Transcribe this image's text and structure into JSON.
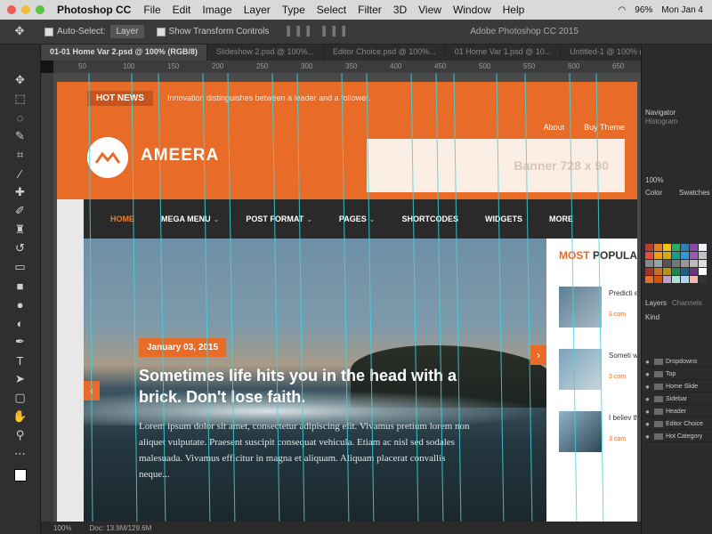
{
  "app": {
    "name": "Photoshop CC",
    "window_title": "Adobe Photoshop CC 2015",
    "menu": [
      "File",
      "Edit",
      "Image",
      "Layer",
      "Type",
      "Select",
      "Filter",
      "3D",
      "View",
      "Window",
      "Help"
    ],
    "clock": "Mon Jan 4",
    "battery": "96%"
  },
  "options_bar": {
    "auto_select_label": "Auto-Select:",
    "auto_select_value": "Layer",
    "transform_label": "Show Transform Controls"
  },
  "tabs": [
    "01-01 Home Var 2.psd @ 100% (RGB/8)",
    "Slideshow 2.psd @ 100%...",
    "Editor Choice.psd @ 100%...",
    "01 Home Var 1.psd @ 10...",
    "Untitled-1 @ 100% (phon..."
  ],
  "ruler": [
    "50",
    "100",
    "150",
    "200",
    "250",
    "300",
    "350",
    "400",
    "450",
    "500",
    "550",
    "600",
    "650"
  ],
  "site": {
    "hot_news": "HOT NEWS",
    "tagline": "Innovation distinguishes between a leader and a follower.",
    "logo": "AMEERA",
    "top_links": [
      "About",
      "Buy Theme"
    ],
    "banner": "Banner 728 x 90",
    "nav": [
      "HOME",
      "MEGA MENU",
      "POST FORMAT",
      "PAGES",
      "SHORTCODES",
      "WIDGETS",
      "MORE"
    ],
    "hero": {
      "date": "January 03, 2015",
      "headline": "Sometimes life hits you in the head with a brick. Don't lose faith.",
      "excerpt": "Lorem ipsum dolor sit amet, consectetur adipiscing elit. Vivamus pretium lorem non aliquet vulputate. Praesent suscipit consequat vehicula. Etiam ac nisl sed sodales malesuada. Vivamus efficitur in magna et aliquam. Aliquam placerat convallis neque...",
      "prev_arrow": "‹",
      "next_arrow": "›"
    },
    "popular": {
      "title_accent": "MOST",
      "title_rest": "POPULAR",
      "items": [
        {
          "title": "Predicti especia",
          "meta": "3 com"
        },
        {
          "title": "Someti will be",
          "meta": "3 com"
        },
        {
          "title": "I believ that is",
          "meta": "3 com"
        }
      ]
    }
  },
  "panels": {
    "navigator": "Navigator",
    "histogram": "Histogram",
    "zoom": "100%",
    "color_tab": "Color",
    "swatches_tab": "Swatches",
    "layers_tab": "Layers",
    "channels_tab": "Channels",
    "kind": "Kind",
    "layers": [
      "Dropdowns",
      "Top",
      "Home Slide",
      "Sidebar",
      "Header",
      "Editor Choice",
      "Hot Category"
    ]
  },
  "status": {
    "zoom": "100%",
    "doc": "Doc: 13.9M/129.6M"
  },
  "colors": {
    "accent": "#e86b28",
    "nav_bg": "#2a2a2a",
    "guide": "#3fd6e0"
  }
}
